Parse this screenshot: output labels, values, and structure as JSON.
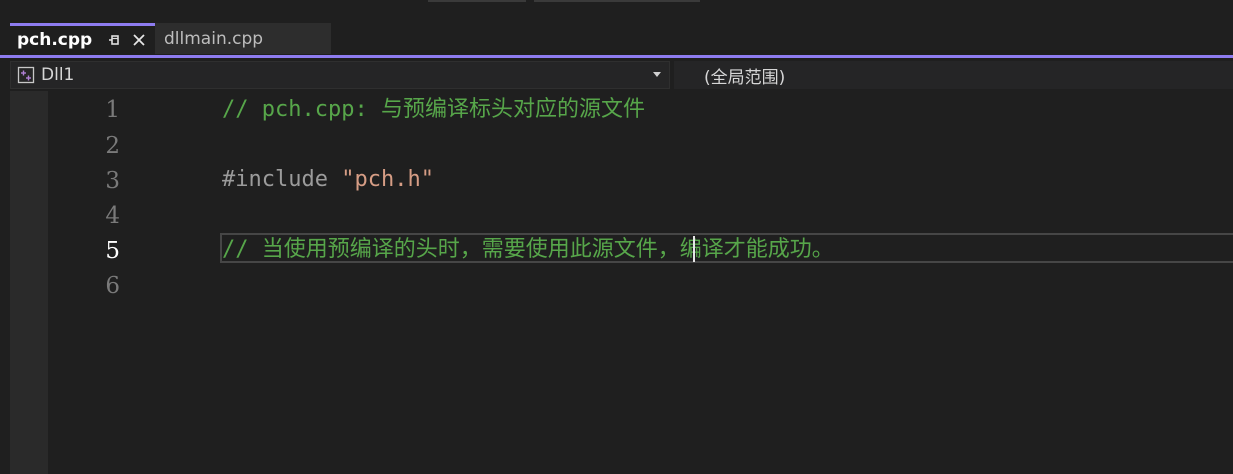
{
  "tabs": [
    {
      "label": "pch.cpp",
      "active": true,
      "pinned": true,
      "closable": true
    },
    {
      "label": "dllmain.cpp",
      "active": false
    }
  ],
  "nav": {
    "project": "Dll1",
    "scope": "(全局范围)"
  },
  "editor": {
    "current_line": 5,
    "lines": [
      {
        "number": "1",
        "text": "// pch.cpp: 与预编译标头对应的源文件"
      },
      {
        "number": "2",
        "text": ""
      },
      {
        "number": "3",
        "directive": "#include ",
        "string": "\"pch.h\""
      },
      {
        "number": "4",
        "text": ""
      },
      {
        "number": "5",
        "text": "// 当使用预编译的头时，需要使用此源文件，编译才能成功。"
      },
      {
        "number": "6",
        "text": ""
      }
    ]
  },
  "colors": {
    "accent": "#8e7cf0",
    "comment": "#57a64a",
    "string": "#d69d85",
    "directive": "#9b9b9b",
    "background": "#1f1f1f"
  }
}
